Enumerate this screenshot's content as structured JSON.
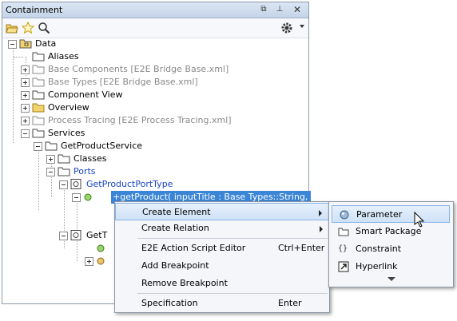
{
  "window": {
    "title": "Containment"
  },
  "tree": {
    "data": "Data",
    "aliases": "Aliases",
    "base_components": "Base Components [E2E Bridge Base.xml]",
    "base_types": "Base Types [E2E Bridge Base.xml]",
    "component_view": "Component View",
    "overview": "Overview",
    "process_tracing": "Process Tracing [E2E Process Tracing.xml]",
    "services": "Services",
    "get_product_service": "GetProductService",
    "classes": "Classes",
    "ports": "Ports",
    "get_product_port_type": "GetProductPortType",
    "operation": "+getProduct( inputTitle : Base Types::String, outpu",
    "get_t": "GetT"
  },
  "context_menu": {
    "create_element": "Create Element",
    "create_relation": "Create Relation",
    "action_script_editor": "E2E Action Script Editor",
    "action_script_shortcut": "Ctrl+Enter",
    "add_breakpoint": "Add Breakpoint",
    "remove_breakpoint": "Remove Breakpoint",
    "specification": "Specification",
    "specification_shortcut": "Enter"
  },
  "submenu": {
    "parameter": "Parameter",
    "smart_package": "Smart Package",
    "constraint": "Constraint",
    "hyperlink": "Hyperlink"
  },
  "colors": {
    "selection": "#3b85d6",
    "menu_highlight": "#cfe2f7",
    "inactive_text": "#8a8a8a",
    "link_text": "#1846c7"
  }
}
